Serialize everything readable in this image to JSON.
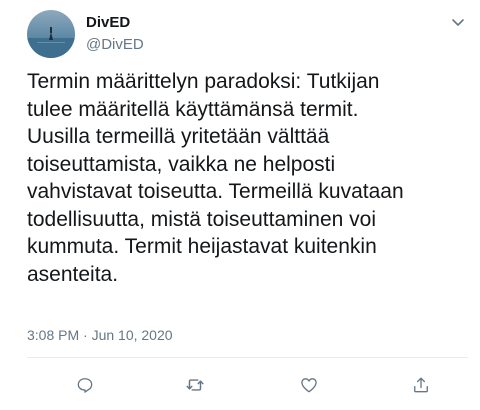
{
  "author": {
    "name": "DivED",
    "handle": "@DivED"
  },
  "tweet": {
    "lines": [
      "Termin määrittelyn paradoksi: Tutkijan",
      "tulee määritellä käyttämänsä termit.",
      "Uusilla termeillä yritetään välttää",
      "toiseuttamista, vaikka ne helposti",
      "vahvistavat toiseutta. Termeillä kuvataan",
      "todellisuutta, mistä toiseuttaminen voi",
      "kummuta. Termit heijastavat kuitenkin",
      "asenteita."
    ],
    "timestamp": "3:08 PM · Jun 10, 2020"
  },
  "icons": {
    "more": "chevron-down-icon",
    "reply": "comment-icon",
    "retweet": "retweet-icon",
    "like": "heart-icon",
    "share": "share-icon"
  },
  "colors": {
    "text": "#14171a",
    "secondary": "#657786",
    "divider": "#e6ecf0"
  }
}
